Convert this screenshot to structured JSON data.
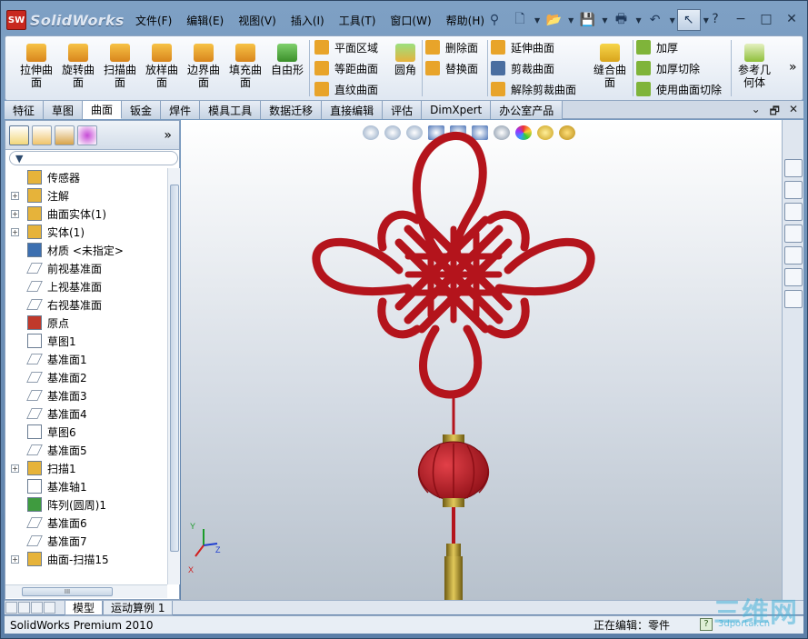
{
  "app": {
    "logo_text": "SolidWorks",
    "logo_badge": "SW"
  },
  "menu": [
    "文件(F)",
    "编辑(E)",
    "视图(V)",
    "插入(I)",
    "工具(T)",
    "窗口(W)",
    "帮助(H)"
  ],
  "window_controls": {
    "help": "?",
    "minimize": "−",
    "restore": "□",
    "close": "✕"
  },
  "ribbon": {
    "large_buttons": [
      "拉伸曲\n面",
      "旋转曲\n面",
      "扫描曲\n面",
      "放样曲\n面",
      "边界曲\n面",
      "填充曲\n面",
      "自由形"
    ],
    "group1": [
      "平面区域",
      "等距曲面",
      "直纹曲面"
    ],
    "fillet": "圆角",
    "group2": [
      "删除面",
      "替换面"
    ],
    "group3": [
      "延伸曲面",
      "剪裁曲面",
      "解除剪裁曲面"
    ],
    "knit": "缝合曲\n面",
    "group4": [
      "加厚",
      "加厚切除",
      "使用曲面切除"
    ],
    "refgeom": "参考几\n何体",
    "more": "»"
  },
  "command_tabs": [
    "特征",
    "草图",
    "曲面",
    "钣金",
    "焊件",
    "模具工具",
    "数据迁移",
    "直接编辑",
    "评估",
    "DimXpert",
    "办公室产品"
  ],
  "active_command_tab": "曲面",
  "doc_controls": {
    "pin": "⌄",
    "restore": "🗗",
    "close": "✕"
  },
  "panel_more": "»",
  "tree": [
    {
      "label": "传感器",
      "expand": "",
      "icon": "sensor-icon",
      "color": "#e6b33a"
    },
    {
      "label": "注解",
      "expand": "+",
      "icon": "annotation-icon",
      "color": "#e6b33a"
    },
    {
      "label": "曲面实体(1)",
      "expand": "+",
      "icon": "surface-body-icon",
      "color": "#e6b33a"
    },
    {
      "label": "实体(1)",
      "expand": "+",
      "icon": "solid-body-icon",
      "color": "#e6b33a"
    },
    {
      "label": "材质 <未指定>",
      "expand": "",
      "icon": "material-icon",
      "color": "#3c6fb0"
    },
    {
      "label": "前视基准面",
      "expand": "",
      "icon": "plane-icon",
      "color": "#ffffff"
    },
    {
      "label": "上视基准面",
      "expand": "",
      "icon": "plane-icon",
      "color": "#ffffff"
    },
    {
      "label": "右视基准面",
      "expand": "",
      "icon": "plane-icon",
      "color": "#ffffff"
    },
    {
      "label": "原点",
      "expand": "",
      "icon": "origin-icon",
      "color": "#c0392b"
    },
    {
      "label": "草图1",
      "expand": "",
      "icon": "sketch-icon",
      "color": "#ffffff"
    },
    {
      "label": "基准面1",
      "expand": "",
      "icon": "plane-icon",
      "color": "#ffffff"
    },
    {
      "label": "基准面2",
      "expand": "",
      "icon": "plane-icon",
      "color": "#ffffff"
    },
    {
      "label": "基准面3",
      "expand": "",
      "icon": "plane-icon",
      "color": "#ffffff"
    },
    {
      "label": "基准面4",
      "expand": "",
      "icon": "plane-icon",
      "color": "#ffffff"
    },
    {
      "label": "草图6",
      "expand": "",
      "icon": "sketch-icon",
      "color": "#ffffff"
    },
    {
      "label": "基准面5",
      "expand": "",
      "icon": "plane-icon",
      "color": "#ffffff"
    },
    {
      "label": "扫描1",
      "expand": "+",
      "icon": "sweep-icon",
      "color": "#e6b33a"
    },
    {
      "label": "基准轴1",
      "expand": "",
      "icon": "axis-icon",
      "color": "#ffffff"
    },
    {
      "label": "阵列(圆周)1",
      "expand": "",
      "icon": "circular-pattern-icon",
      "color": "#3f9b3f"
    },
    {
      "label": "基准面6",
      "expand": "",
      "icon": "plane-icon",
      "color": "#ffffff"
    },
    {
      "label": "基准面7",
      "expand": "",
      "icon": "plane-icon",
      "color": "#ffffff"
    },
    {
      "label": "曲面-扫描15",
      "expand": "+",
      "icon": "surface-sweep-icon",
      "color": "#e6b33a"
    }
  ],
  "hscroll_grip": "III",
  "bottom_tabs": [
    "模型",
    "运动算例 1"
  ],
  "status": {
    "product": "SolidWorks Premium 2010",
    "editing": "正在编辑：零件",
    "help": "?"
  },
  "watermark": {
    "big": "三维网",
    "small": "3dportal.cn"
  },
  "triad": {
    "x": "X",
    "y": "Y",
    "z": "Z"
  },
  "colors": {
    "knot": "#b4141c",
    "gold": "#b89a2a",
    "ribbon_bg": "#e6edf6"
  }
}
